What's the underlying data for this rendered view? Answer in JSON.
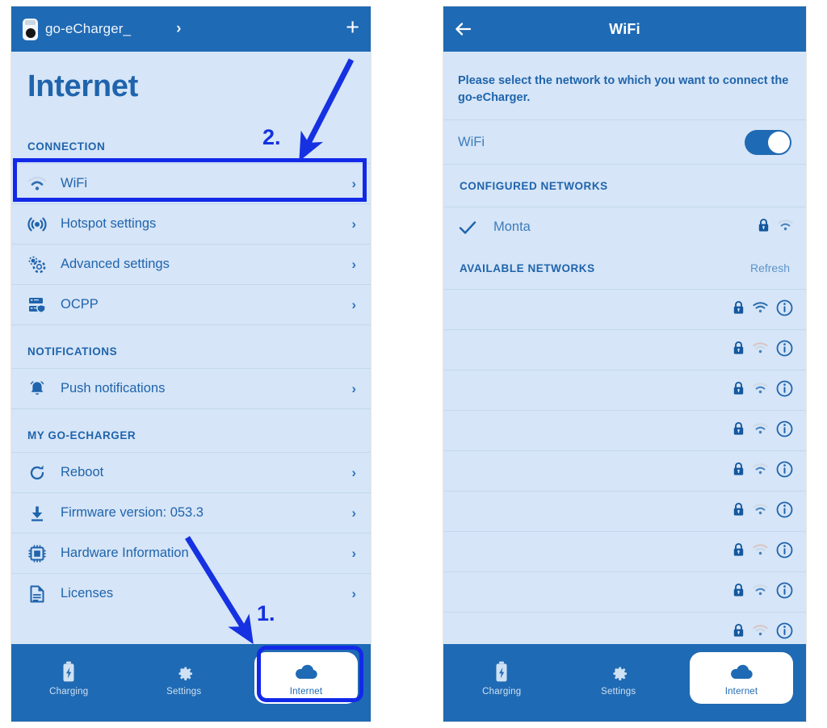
{
  "meta": {
    "accent_blue": "#1f6ab4",
    "panel_bg": "#d6e5f7",
    "text_blue": "#1f64ac",
    "highlight_blue": "#1229e8"
  },
  "left_panel": {
    "appbar": {
      "device_icon": "charger-icon",
      "device_name": "go-eCharger_",
      "chevron": "›",
      "add_label": "+"
    },
    "page_title": "Internet",
    "sections": [
      {
        "heading": "CONNECTION",
        "items": [
          {
            "label": "WiFi",
            "icon": "wifi-icon",
            "chevron": "›"
          },
          {
            "label": "Hotspot settings",
            "icon": "hotspot-icon",
            "chevron": "›"
          },
          {
            "label": "Advanced settings",
            "icon": "gears-icon",
            "chevron": "›"
          },
          {
            "label": "OCPP",
            "icon": "server-shield-icon",
            "chevron": "›"
          }
        ]
      },
      {
        "heading": "NOTIFICATIONS",
        "items": [
          {
            "label": "Push notifications",
            "icon": "bell-icon",
            "chevron": "›"
          }
        ]
      },
      {
        "heading": "MY GO-ECHARGER",
        "items": [
          {
            "label": "Reboot",
            "icon": "refresh-icon",
            "chevron": "›"
          },
          {
            "label": "Firmware version: 053.3",
            "icon": "download-icon",
            "chevron": "›"
          },
          {
            "label": "Hardware Information",
            "icon": "chip-icon",
            "chevron": "›"
          },
          {
            "label": "Licenses",
            "icon": "document-icon",
            "chevron": "›"
          }
        ]
      }
    ],
    "bottom_nav": [
      {
        "label": "Charging",
        "icon": "battery-bolt-icon",
        "active": false
      },
      {
        "label": "Settings",
        "icon": "gear-icon",
        "active": false
      },
      {
        "label": "Internet",
        "icon": "cloud-icon",
        "active": true
      }
    ]
  },
  "right_panel": {
    "appbar": {
      "back_icon": "back-arrow-icon",
      "title": "WiFi"
    },
    "instruction": "Please select the network to which you want to connect the go-eCharger.",
    "wifi_toggle": {
      "label": "WiFi",
      "state": "on"
    },
    "configured": {
      "heading": "CONFIGURED NETWORKS",
      "networks": [
        {
          "name": "Monta",
          "connected": true,
          "lock": true,
          "signal": 2,
          "info": false
        }
      ]
    },
    "available": {
      "heading": "AVAILABLE NETWORKS",
      "refresh_label": "Refresh",
      "networks": [
        {
          "name": "",
          "lock": true,
          "signal": 3,
          "info": true
        },
        {
          "name": "",
          "lock": true,
          "signal": 1,
          "info": true
        },
        {
          "name": "",
          "lock": true,
          "signal": 2,
          "info": true
        },
        {
          "name": "",
          "lock": true,
          "signal": 2,
          "info": true
        },
        {
          "name": "",
          "lock": true,
          "signal": 2,
          "info": true
        },
        {
          "name": "",
          "lock": true,
          "signal": 2,
          "info": true
        },
        {
          "name": "",
          "lock": true,
          "signal": 1,
          "info": true
        },
        {
          "name": "",
          "lock": true,
          "signal": 2,
          "info": true
        },
        {
          "name": "",
          "lock": true,
          "signal": 1,
          "info": true
        }
      ]
    },
    "bottom_nav": [
      {
        "label": "Charging",
        "icon": "battery-bolt-icon",
        "active": false
      },
      {
        "label": "Settings",
        "icon": "gear-icon",
        "active": false
      },
      {
        "label": "Internet",
        "icon": "cloud-icon",
        "active": true
      }
    ]
  },
  "annotations": {
    "step_one": "1.",
    "step_two": "2."
  }
}
